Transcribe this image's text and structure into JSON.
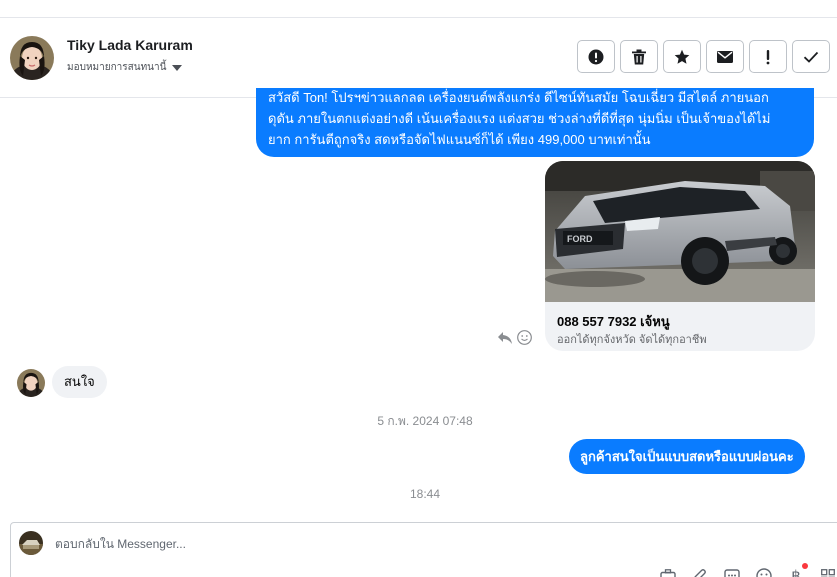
{
  "contact": {
    "name": "Tiky Lada Karuram",
    "assign_label": "มอบหมายการสนทนานี้"
  },
  "header_actions": [
    {
      "name": "spam-button",
      "icon": "exclamation-circle-icon"
    },
    {
      "name": "delete-button",
      "icon": "trash-icon"
    },
    {
      "name": "star-button",
      "icon": "star-icon"
    },
    {
      "name": "mark-unread-button",
      "icon": "envelope-icon"
    },
    {
      "name": "follow-up-button",
      "icon": "exclamation-icon"
    },
    {
      "name": "done-button",
      "icon": "checkmark-icon"
    }
  ],
  "messages": {
    "outgoing_top": {
      "line1": "สวัสดี Ton!  โปรฯข่าวแลกลด เครื่องยนต์พลังแกร่ง ดีไซน์ทันสมัย โฉบเฉี่ยว มีสไตล์ ภายนอก",
      "line2": "ดุดัน ภายในตกแต่งอย่างดี เน้นเครื่องแรง แต่งสวย ช่วงล่างที่ดีที่สุด นุ่มนิ่ม เป็นเจ้าของได้ไม่",
      "line3": "ยาก การันตีถูกจริง สดหรือจัดไฟแนนซ์ก็ได้ เพียง 499,000 บาทเท่านั้น"
    },
    "card": {
      "title": "088 557 7932 เจ้หนู",
      "subtitle": "ออกได้ทุกจังหวัด จัดได้ทุกอาชีพ"
    },
    "incoming": {
      "text": "สนใจ"
    },
    "timestamp_1": "5 ก.พ. 2024 07:48",
    "outgoing_bottom": {
      "text": "ลูกค้าสนใจเป็นแบบสดหรือแบบผ่อนคะ"
    },
    "timestamp_2": "18:44"
  },
  "composer": {
    "placeholder": "ตอบกลับใน Messenger..."
  },
  "colors": {
    "outgoing_bubble": "#0a7cff",
    "incoming_bubble": "#f0f2f5",
    "notification_dot": "#fa383e"
  }
}
